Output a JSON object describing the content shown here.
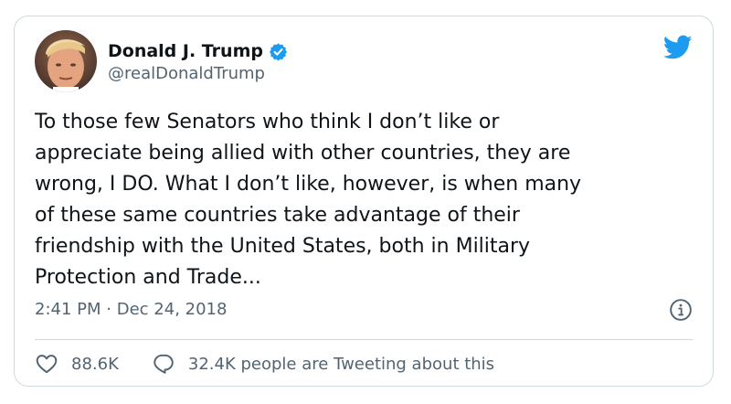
{
  "author": {
    "display_name": "Donald J. Trump",
    "handle": "@realDonaldTrump",
    "verified": true
  },
  "tweet": {
    "lines": [
      "To those few Senators who think I don’t like or",
      "appreciate being allied with other countries, they are",
      "wrong, I DO. What I don’t like, however, is when many",
      "of these same countries take advantage of their",
      "friendship with the United States, both in Military",
      "Protection and Trade..."
    ],
    "time": "2:41 PM",
    "separator": "·",
    "date": "Dec 24, 2018"
  },
  "actions": {
    "likes": "88.6K",
    "tweeting": "32.4K people are Tweeting about this"
  },
  "icons": {
    "brand": "twitter-bird-icon",
    "verified": "verified-badge-icon",
    "info": "info-icon",
    "like": "heart-icon",
    "reply": "speech-bubble-icon"
  },
  "colors": {
    "brand_blue": "#1d9bf0",
    "text": "#0f1419",
    "secondary": "#536471",
    "border": "#cfd9de"
  }
}
